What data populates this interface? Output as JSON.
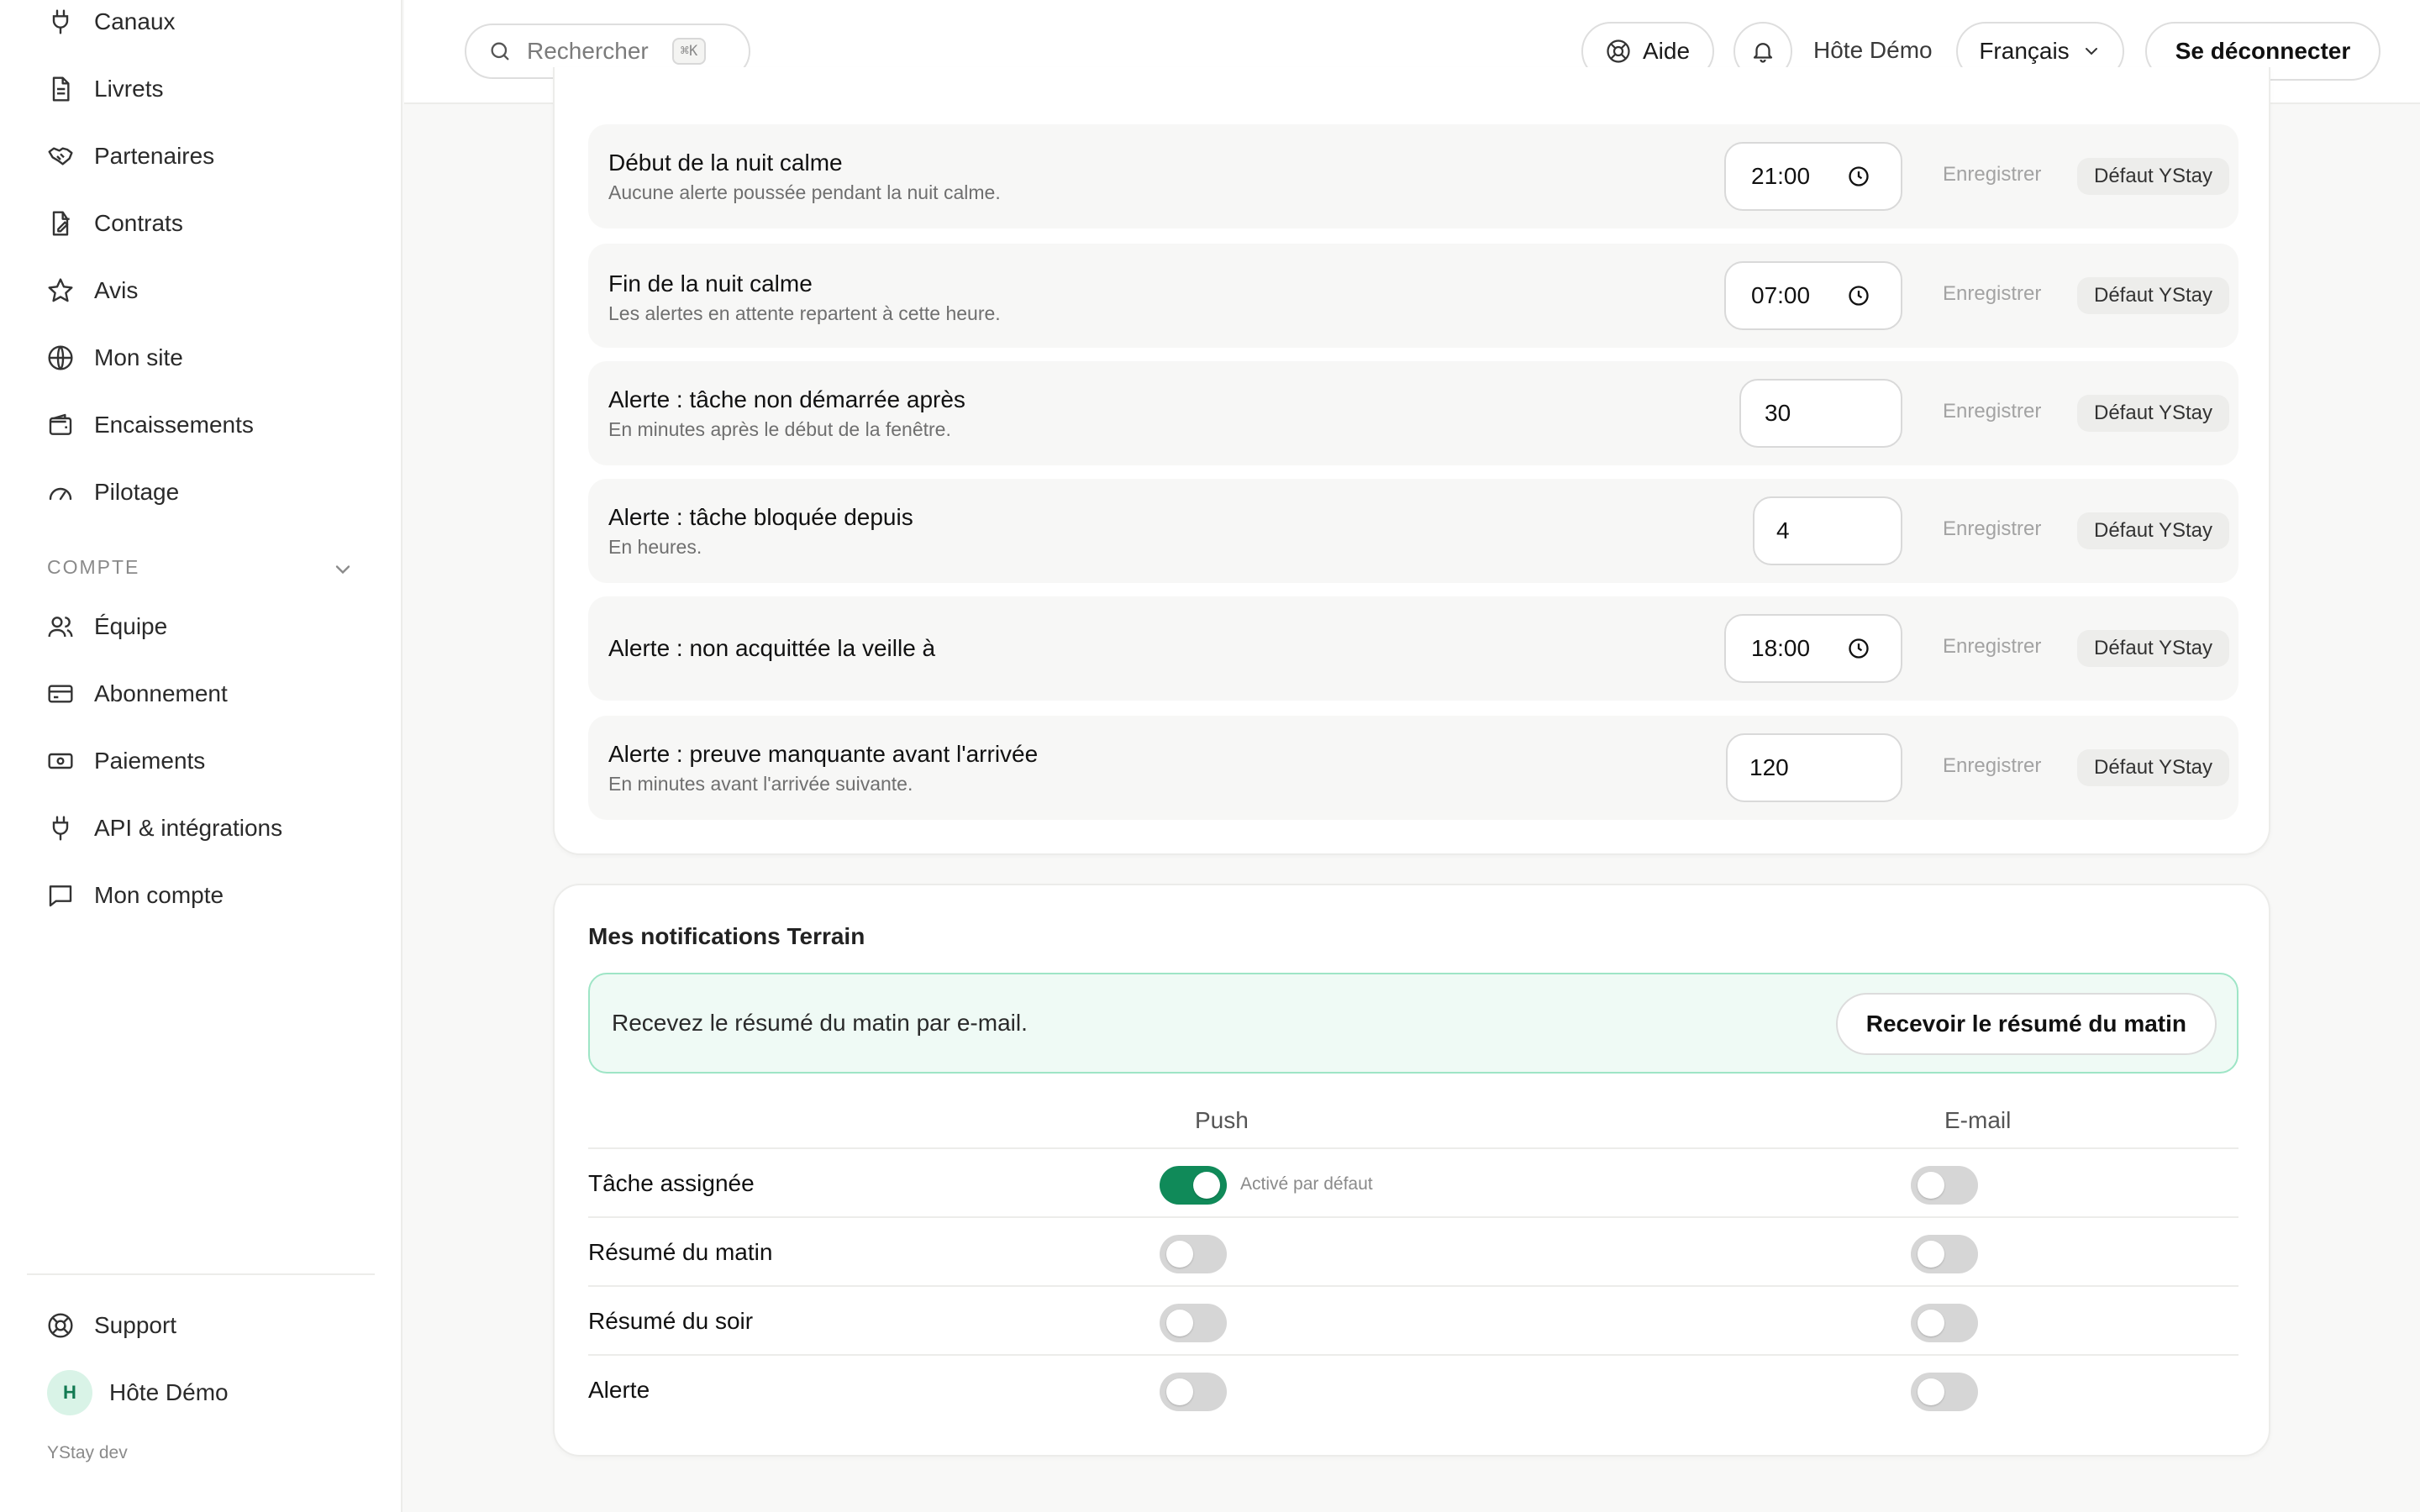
{
  "sidebar": {
    "items": [
      {
        "label": "Canaux",
        "icon": "plug-icon"
      },
      {
        "label": "Livrets",
        "icon": "document-icon"
      },
      {
        "label": "Partenaires",
        "icon": "handshake-icon"
      },
      {
        "label": "Contrats",
        "icon": "contract-icon"
      },
      {
        "label": "Avis",
        "icon": "star-icon"
      },
      {
        "label": "Mon site",
        "icon": "globe-icon"
      },
      {
        "label": "Encaissements",
        "icon": "wallet-icon"
      },
      {
        "label": "Pilotage",
        "icon": "gauge-icon"
      }
    ],
    "section_label": "COMPTE",
    "account_items": [
      {
        "label": "Équipe",
        "icon": "users-icon"
      },
      {
        "label": "Abonnement",
        "icon": "credit-card-icon"
      },
      {
        "label": "Paiements",
        "icon": "banknote-icon"
      },
      {
        "label": "API & intégrations",
        "icon": "plug-icon"
      },
      {
        "label": "Mon compte",
        "icon": "chat-icon"
      }
    ],
    "support_label": "Support",
    "user_initial": "H",
    "user_name": "Hôte Démo",
    "env_label": "YStay dev"
  },
  "topbar": {
    "search_placeholder": "Rechercher",
    "search_shortcut": "⌘K",
    "help_label": "Aide",
    "host_name": "Hôte Démo",
    "language": "Français",
    "logout_label": "Se déconnecter"
  },
  "quiet_settings": {
    "save_label": "Enregistrer",
    "default_label": "Défaut YStay",
    "rows": [
      {
        "title": "Début de la nuit calme",
        "description": "Aucune alerte poussée pendant la nuit calme.",
        "value": "21:00"
      },
      {
        "title": "Fin de la nuit calme",
        "description": "Les alertes en attente repartent à cette heure.",
        "value": "07:00"
      },
      {
        "title": "Alerte : tâche non démarrée après",
        "description": "En minutes après le début de la fenêtre.",
        "value": "30"
      },
      {
        "title": "Alerte : tâche bloquée depuis",
        "description": "En heures.",
        "value": "4"
      },
      {
        "title": "Alerte : non acquittée la veille à",
        "description": "",
        "value": "18:00"
      },
      {
        "title": "Alerte : preuve manquante avant l'arrivée",
        "description": "En minutes avant l'arrivée suivante.",
        "value": "120"
      }
    ]
  },
  "notifications": {
    "title": "Mes notifications Terrain",
    "banner_text": "Recevez le résumé du matin par e-mail.",
    "banner_button": "Recevoir le résumé du matin",
    "col_push": "Push",
    "col_email": "E-mail",
    "default_note": "Activé par défaut",
    "rows": [
      {
        "label": "Tâche assignée",
        "push": true,
        "email": false
      },
      {
        "label": "Résumé du matin",
        "push": false,
        "email": false
      },
      {
        "label": "Résumé du soir",
        "push": false,
        "email": false
      },
      {
        "label": "Alerte",
        "push": false,
        "email": false
      }
    ]
  },
  "colors": {
    "accent": "#108a59",
    "banner_bg": "#effaf5",
    "banner_border": "#9ee5c6"
  }
}
